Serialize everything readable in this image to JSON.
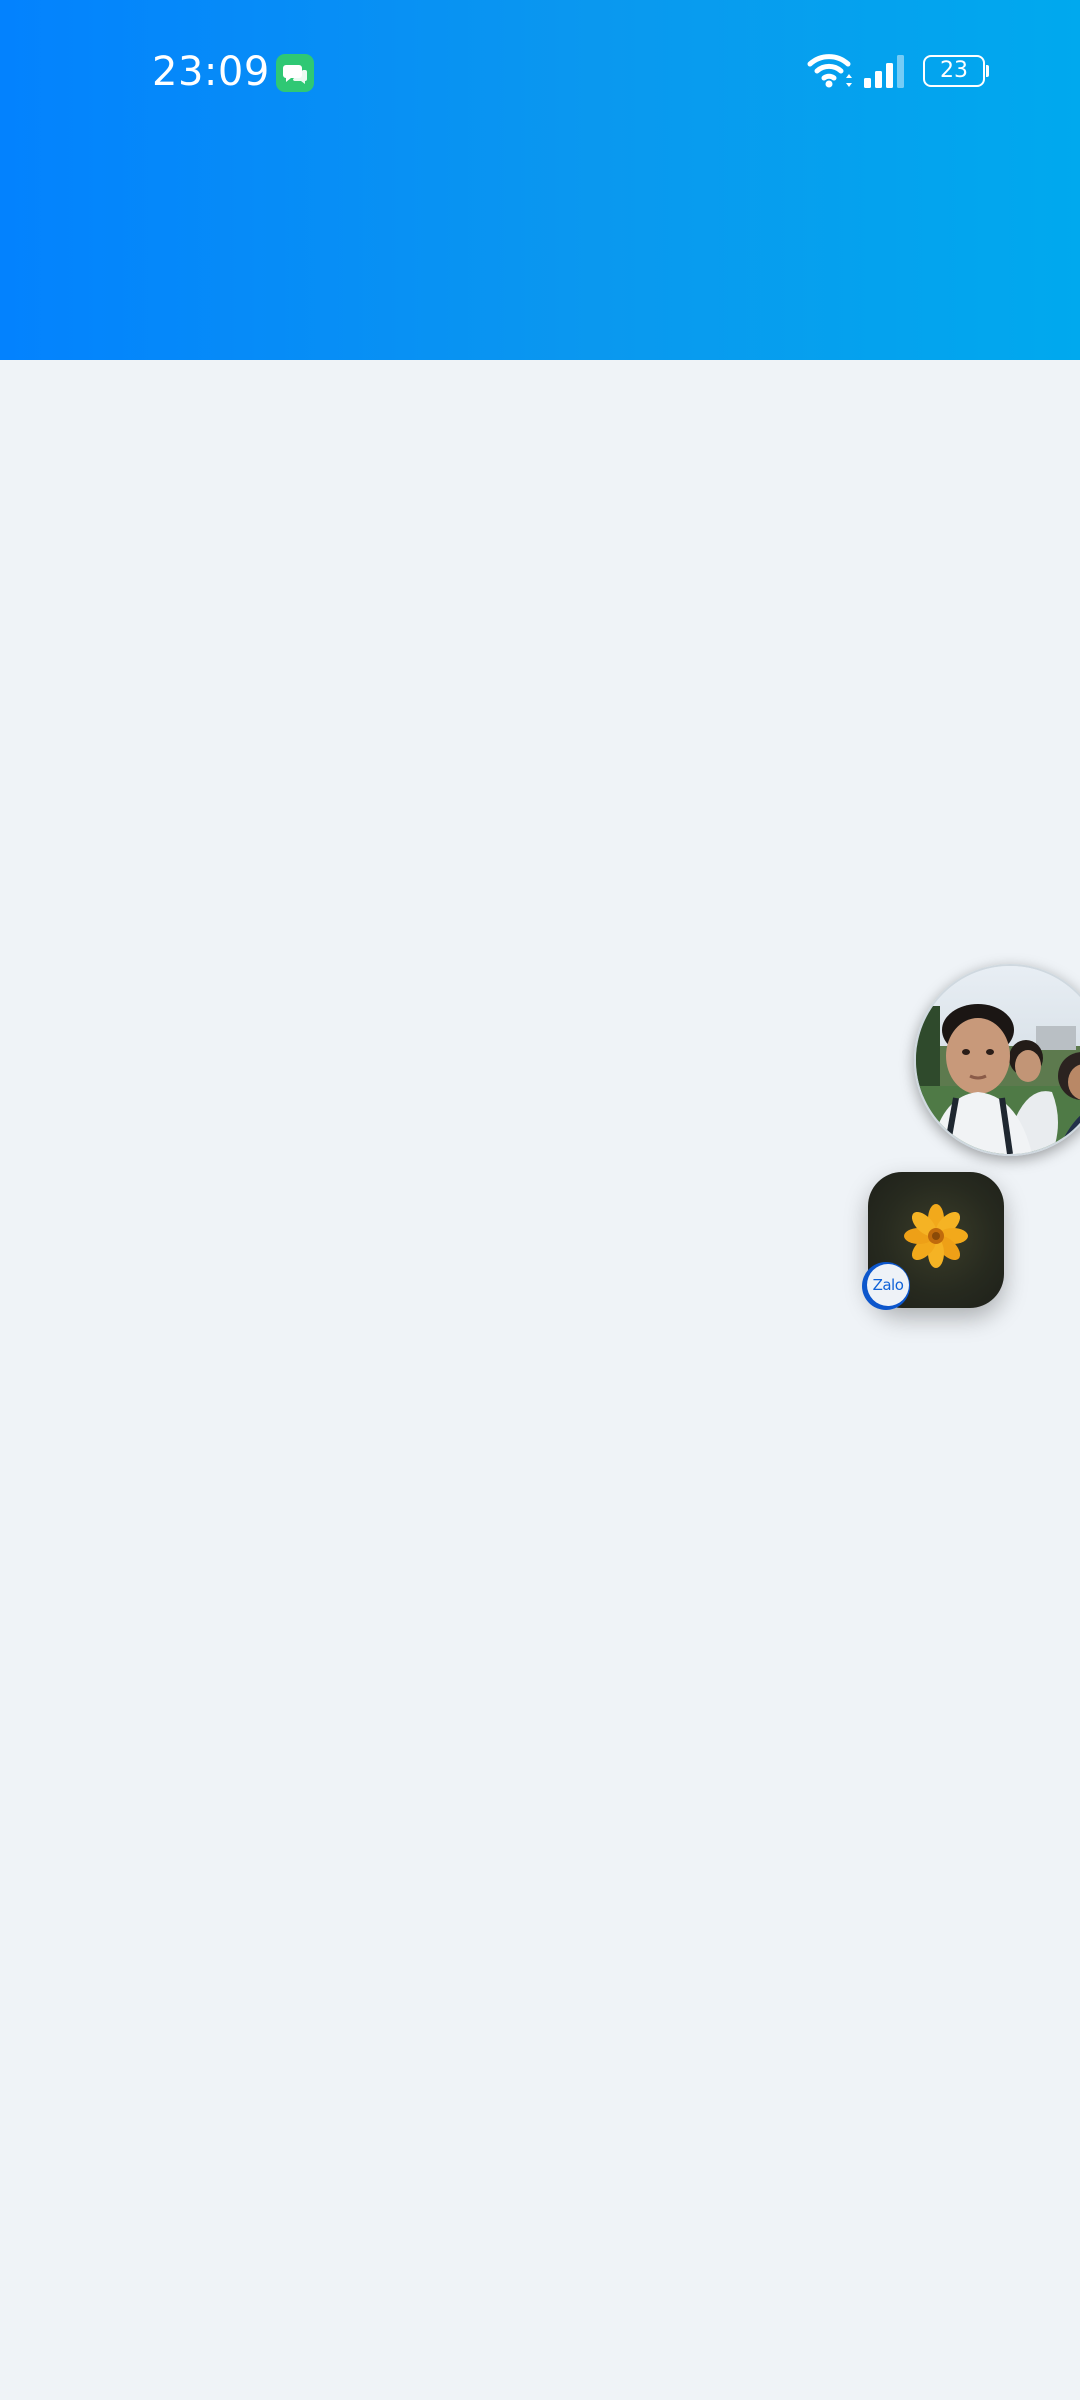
{
  "status_bar": {
    "time": "23:09",
    "battery_level": "23",
    "notification_icon": "messages-icon",
    "wifi_icon": "wifi-icon",
    "signal_icon": "cellular-signal-icon",
    "battery_icon": "battery-icon"
  },
  "header": {
    "gradient_start": "#0382fe",
    "gradient_end": "#00a9ee"
  },
  "page": {
    "background": "#eff3f7"
  },
  "chat_heads": [
    {
      "type": "contact-photo",
      "icon": "group-photo-avatar"
    },
    {
      "type": "app-chat-head",
      "icon": "yellow-flower-avatar",
      "badge_label": "Zalo",
      "badge_color": "#0c56cc"
    }
  ]
}
